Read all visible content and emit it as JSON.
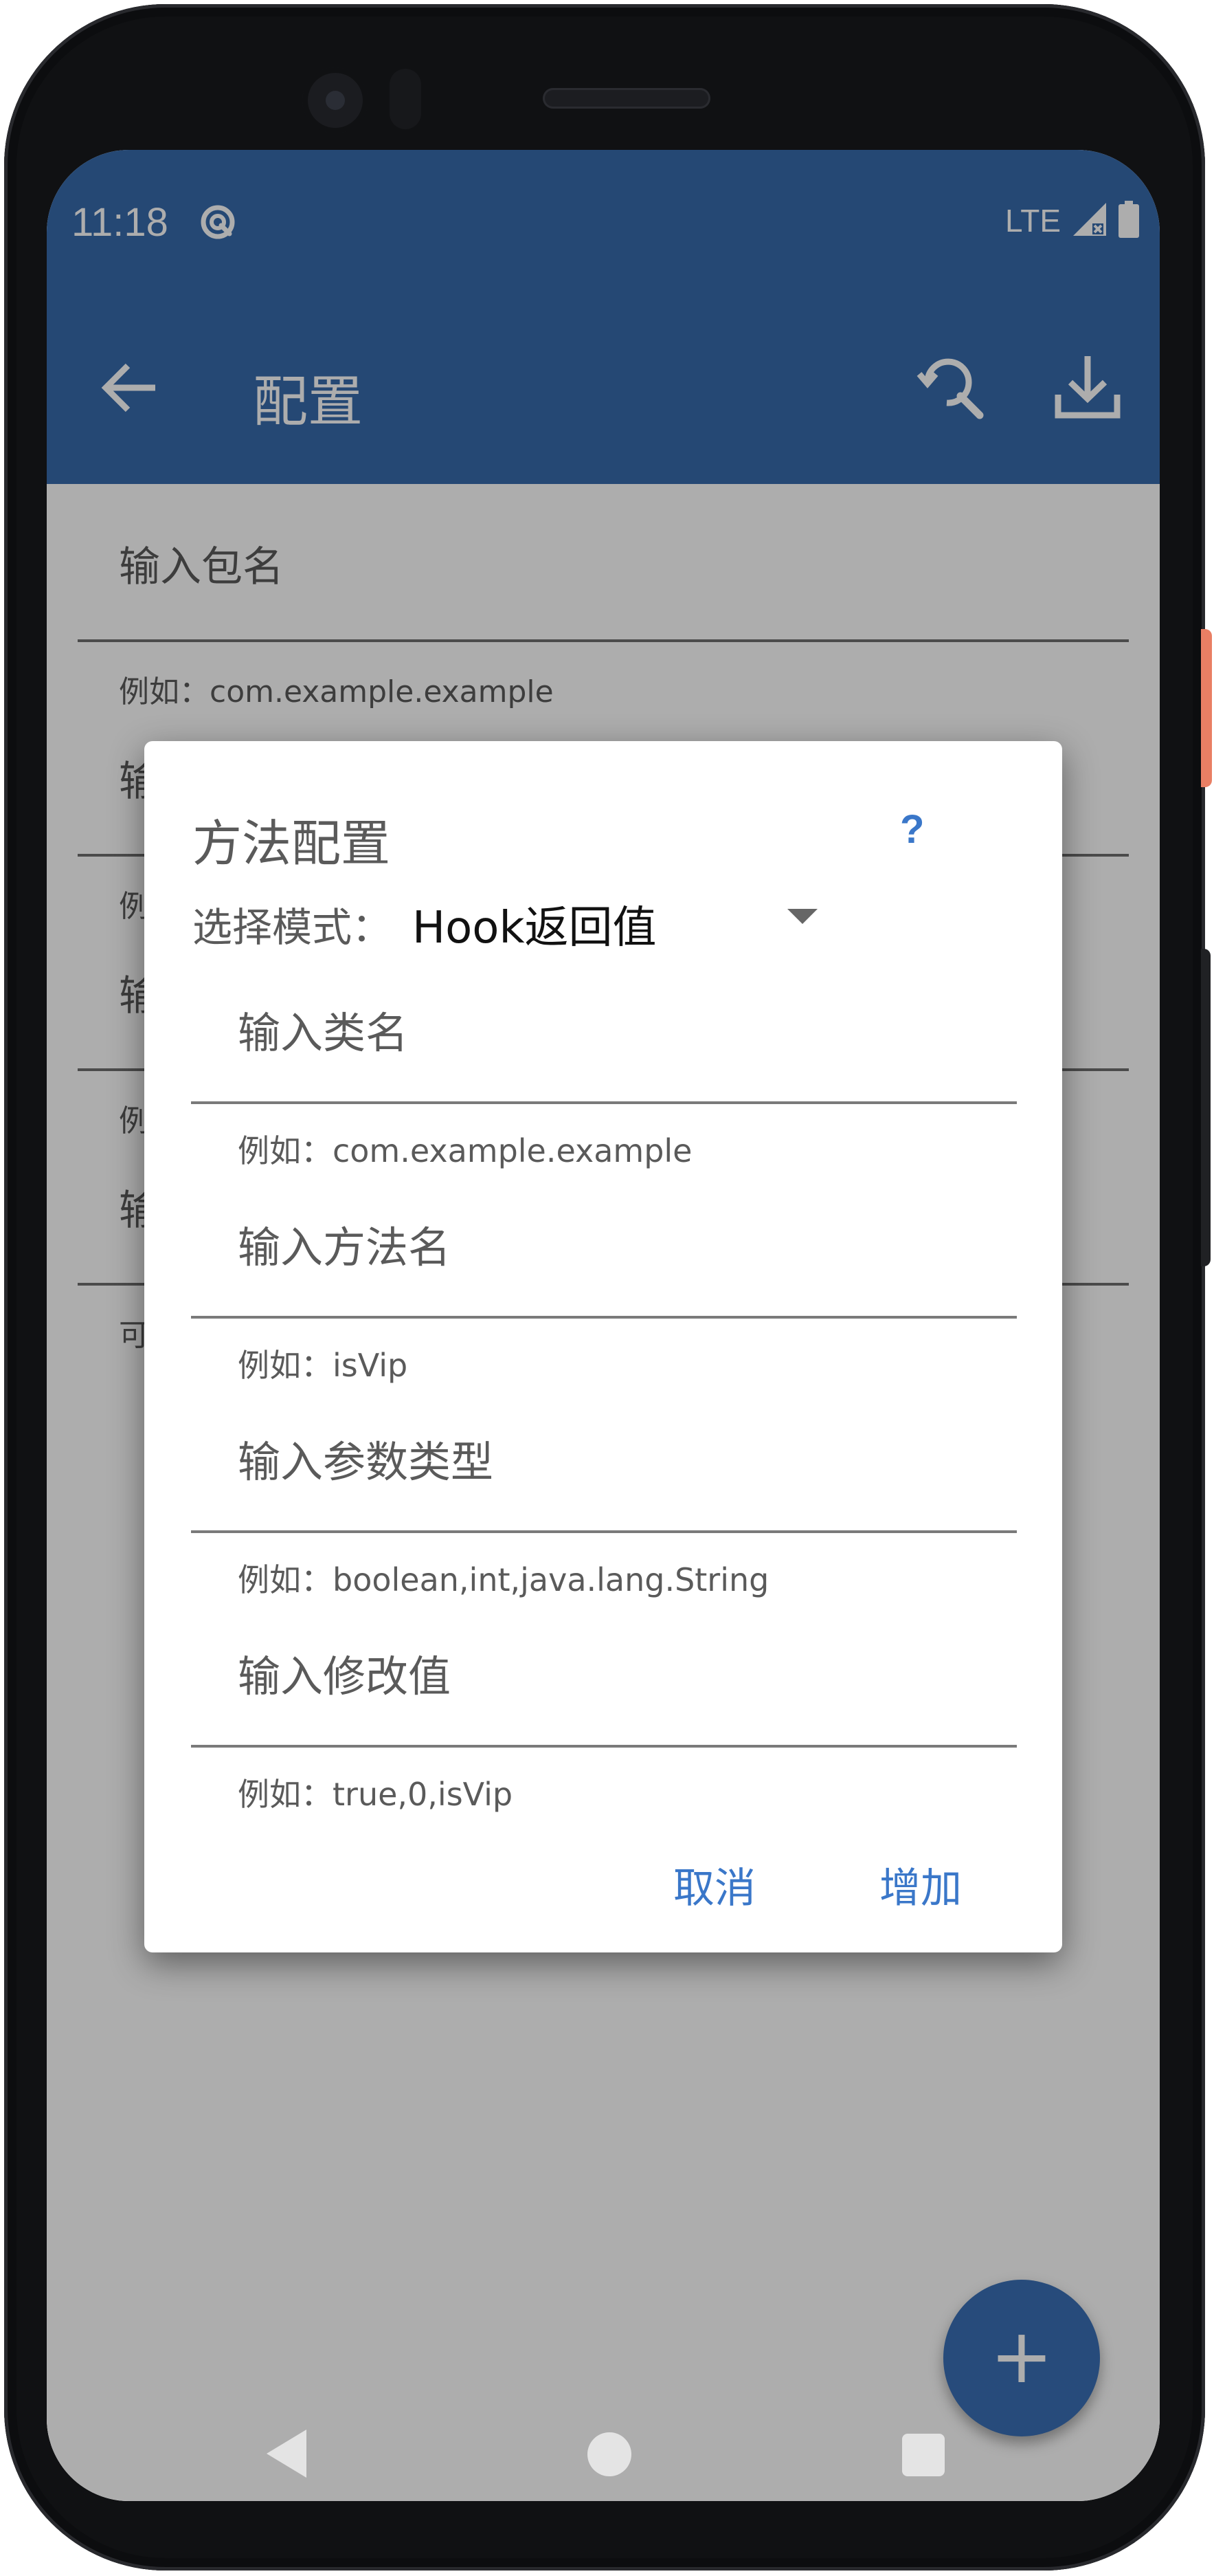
{
  "status_bar": {
    "time": "11:18",
    "network": "LTE",
    "icons": [
      "app-notification-icon",
      "signal-icon",
      "battery-icon"
    ]
  },
  "app_bar": {
    "title": "配置",
    "icons": [
      "back-arrow-icon",
      "search-sync-icon",
      "download-icon"
    ]
  },
  "background_form": {
    "package_input": {
      "label": "输入包名",
      "helper": "例如：com.example.example"
    },
    "obscured_fields": [
      {
        "label": "输",
        "helper": "例"
      },
      {
        "label": "输",
        "helper": "例"
      },
      {
        "label": "输",
        "helper": "可"
      }
    ]
  },
  "fab": {
    "label": "+"
  },
  "nav_bar": {
    "icons": [
      "back-triangle-icon",
      "home-circle-icon",
      "recents-square-icon"
    ]
  },
  "dialog": {
    "title": "方法配置",
    "help_label": "?",
    "mode_label": "选择模式：",
    "mode_value": "Hook返回值",
    "fields": [
      {
        "label": "输入类名",
        "helper": "例如：com.example.example"
      },
      {
        "label": "输入方法名",
        "helper": "例如：isVip"
      },
      {
        "label": "输入参数类型",
        "helper": "例如：boolean,int,java.lang.String"
      },
      {
        "label": "输入修改值",
        "helper": "例如：true,0,isVip"
      }
    ],
    "actions": {
      "cancel_label": "取消",
      "add_label": "增加"
    }
  },
  "colors": {
    "primary": "#376aac",
    "accent": "#3a77c9",
    "scrim": "rgba(0,0,0,0.32)"
  }
}
